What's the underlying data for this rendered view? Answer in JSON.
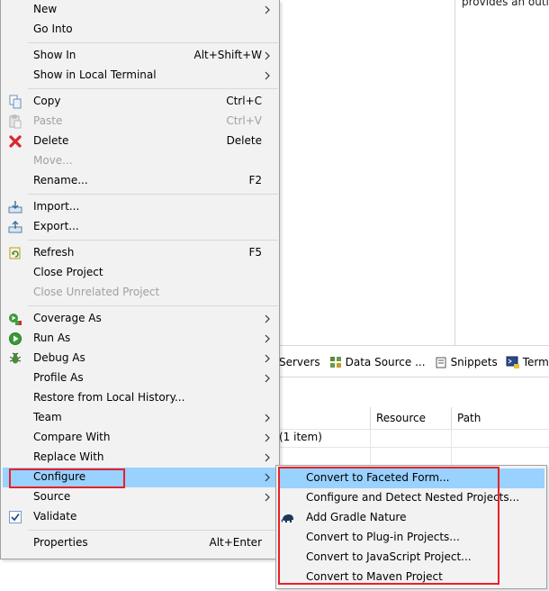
{
  "background": {
    "outline_text": "provides an outline",
    "view_tabs": [
      {
        "label": "Servers",
        "icon": "servers-icon"
      },
      {
        "label": "Data Source ...",
        "icon": "data-source-icon"
      },
      {
        "label": "Snippets",
        "icon": "snippets-icon"
      },
      {
        "label": "Terminal",
        "icon": "terminal-icon"
      }
    ],
    "table": {
      "columns": [
        "Resource",
        "Path"
      ],
      "item_count": "(1 item)"
    }
  },
  "context_menu": {
    "items": [
      {
        "label": "New",
        "submenu": true
      },
      {
        "label": "Go Into"
      },
      {
        "label": "Show In",
        "shortcut": "Alt+Shift+W",
        "submenu": true
      },
      {
        "label": "Show in Local Terminal",
        "submenu": true
      },
      {
        "label": "Copy",
        "shortcut": "Ctrl+C",
        "icon": "copy-icon"
      },
      {
        "label": "Paste",
        "shortcut": "Ctrl+V",
        "icon": "paste-icon",
        "disabled": true
      },
      {
        "label": "Delete",
        "shortcut": "Delete",
        "icon": "delete-icon"
      },
      {
        "label": "Move...",
        "disabled": true
      },
      {
        "label": "Rename...",
        "shortcut": "F2"
      },
      {
        "label": "Import...",
        "icon": "import-icon"
      },
      {
        "label": "Export...",
        "icon": "export-icon"
      },
      {
        "label": "Refresh",
        "shortcut": "F5",
        "icon": "refresh-icon"
      },
      {
        "label": "Close Project"
      },
      {
        "label": "Close Unrelated Project",
        "disabled": true
      },
      {
        "label": "Coverage As",
        "icon": "coverage-icon",
        "submenu": true
      },
      {
        "label": "Run As",
        "icon": "run-icon",
        "submenu": true
      },
      {
        "label": "Debug As",
        "icon": "debug-icon",
        "submenu": true
      },
      {
        "label": "Profile As",
        "submenu": true
      },
      {
        "label": "Restore from Local History..."
      },
      {
        "label": "Team",
        "submenu": true
      },
      {
        "label": "Compare With",
        "submenu": true
      },
      {
        "label": "Replace With",
        "submenu": true
      },
      {
        "label": "Configure",
        "submenu": true,
        "selected": true
      },
      {
        "label": "Source",
        "submenu": true
      },
      {
        "label": "Validate",
        "icon": "checkbox-icon"
      },
      {
        "label": "Properties",
        "shortcut": "Alt+Enter"
      }
    ]
  },
  "configure_submenu": {
    "items": [
      {
        "label": "Convert to Faceted Form...",
        "selected": true
      },
      {
        "label": "Configure and Detect Nested Projects..."
      },
      {
        "label": "Add Gradle Nature",
        "icon": "gradle-elephant-icon"
      },
      {
        "label": "Convert to Plug-in Projects..."
      },
      {
        "label": "Convert to JavaScript Project..."
      },
      {
        "label": "Convert to Maven Project"
      }
    ]
  },
  "colors": {
    "menu_bg": "#f2f2f2",
    "selection": "#99d1ff",
    "highlight_box": "#e8202a",
    "disabled_text": "#a0a0a0"
  }
}
